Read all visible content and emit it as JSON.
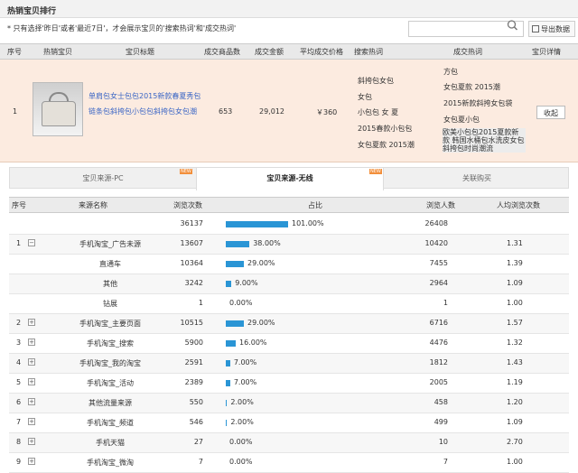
{
  "panel_title": "热销宝贝排行",
  "notice": "* 只有选择'昨日'或者'最近7日'，才会展示宝贝的'搜索热词'和'成交热词'",
  "search_placeholder": "",
  "export_label": "导出数据",
  "columns": [
    "序号",
    "热销宝贝",
    "宝贝标题",
    "成交商品数",
    "成交金额",
    "平均成交价格",
    "搜索热词",
    "成交热词",
    "宝贝详情"
  ],
  "hot_item": {
    "index": "1",
    "title": "单肩包女士包包2015新款春夏秀包链条包斜挎包小包包斜挎包女包潮",
    "qty": "653",
    "amount": "29,012",
    "avg_price": "￥360",
    "search_words": [
      "斜挎包女包",
      "女包",
      "小包包 女 夏",
      "2015春款小包包",
      "女包夏款 2015潮"
    ],
    "deal_words": [
      "方包",
      "女包夏款 2015潮",
      "2015新款斜挎女包袋",
      "女包夏小包",
      "欧美小包包2015夏款新款 韩国水桶包水洗皮女包斜挎包时尚潮流"
    ],
    "collect_label": "收起"
  },
  "tabs": [
    {
      "label": "宝贝来源-PC",
      "tag": "NEW"
    },
    {
      "label": "宝贝来源-无线",
      "tag": "NEW"
    },
    {
      "label": "关联购买",
      "tag": ""
    }
  ],
  "source_columns": [
    "序号",
    "来源名称",
    "浏览次数",
    "占比",
    "浏览人数",
    "人均浏览次数"
  ],
  "sources": [
    {
      "no": "",
      "exp": "",
      "name": "",
      "views": "36137",
      "pct_label": "101.00%",
      "pct": 101,
      "visitors": "26408",
      "avg": ""
    },
    {
      "no": "1",
      "exp": "−",
      "name": "手机淘宝_广告未源",
      "views": "13607",
      "pct_label": "38.00%",
      "pct": 38,
      "visitors": "10420",
      "avg": "1.31"
    },
    {
      "no": "",
      "exp": "",
      "name": "直通车",
      "views": "10364",
      "pct_label": "29.00%",
      "pct": 29,
      "visitors": "7455",
      "avg": "1.39"
    },
    {
      "no": "",
      "exp": "",
      "name": "其他",
      "views": "3242",
      "pct_label": "9.00%",
      "pct": 9,
      "visitors": "2964",
      "avg": "1.09"
    },
    {
      "no": "",
      "exp": "",
      "name": "钻展",
      "views": "1",
      "pct_label": "0.00%",
      "pct": 0,
      "visitors": "1",
      "avg": "1.00"
    },
    {
      "no": "2",
      "exp": "+",
      "name": "手机淘宝_主要页面",
      "views": "10515",
      "pct_label": "29.00%",
      "pct": 29,
      "visitors": "6716",
      "avg": "1.57"
    },
    {
      "no": "3",
      "exp": "+",
      "name": "手机淘宝_搜索",
      "views": "5900",
      "pct_label": "16.00%",
      "pct": 16,
      "visitors": "4476",
      "avg": "1.32"
    },
    {
      "no": "4",
      "exp": "+",
      "name": "手机淘宝_我的淘宝",
      "views": "2591",
      "pct_label": "7.00%",
      "pct": 7,
      "visitors": "1812",
      "avg": "1.43"
    },
    {
      "no": "5",
      "exp": "+",
      "name": "手机淘宝_活动",
      "views": "2389",
      "pct_label": "7.00%",
      "pct": 7,
      "visitors": "2005",
      "avg": "1.19"
    },
    {
      "no": "6",
      "exp": "+",
      "name": "其他流量来源",
      "views": "550",
      "pct_label": "2.00%",
      "pct": 2,
      "visitors": "458",
      "avg": "1.20"
    },
    {
      "no": "7",
      "exp": "+",
      "name": "手机淘宝_频道",
      "views": "546",
      "pct_label": "2.00%",
      "pct": 2,
      "visitors": "499",
      "avg": "1.09"
    },
    {
      "no": "8",
      "exp": "+",
      "name": "手机天猫",
      "views": "27",
      "pct_label": "0.00%",
      "pct": 0,
      "visitors": "10",
      "avg": "2.70"
    },
    {
      "no": "9",
      "exp": "+",
      "name": "手机淘宝_微淘",
      "views": "7",
      "pct_label": "0.00%",
      "pct": 0,
      "visitors": "7",
      "avg": "1.00"
    }
  ],
  "colors": {
    "accent": "#2a95d5",
    "highlight_row": "#fcebe0",
    "link": "#3b66c5"
  }
}
